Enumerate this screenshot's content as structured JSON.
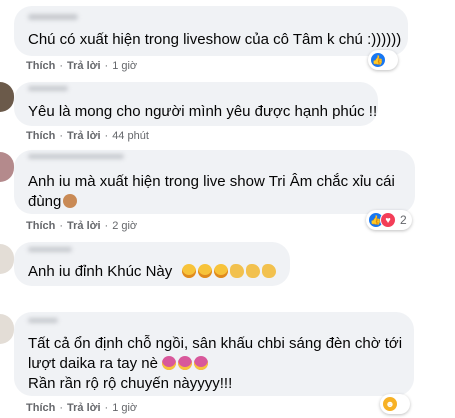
{
  "comments": [
    {
      "text_lines": [
        "Chú có xuất hiện trong liveshow của cô Tâm k chú :))))))"
      ],
      "like_label": "Thích",
      "reply_label": "Trả lời",
      "time": "1 giờ",
      "reaction_icons": [
        "like-icon"
      ],
      "reaction_count": ""
    },
    {
      "text_lines": [
        "Yêu là mong cho người mình yêu được hạnh phúc !!"
      ],
      "like_label": "Thích",
      "reply_label": "Trả lời",
      "time": "44 phút"
    },
    {
      "text_lines": [
        "Anh iu mà xuất hiện trong live show Tri Âm chắc xỉu cái",
        "đùng"
      ],
      "like_label": "Thích",
      "reply_label": "Trả lời",
      "time": "2 giờ",
      "reaction_icons": [
        "like-icon",
        "love-icon"
      ],
      "reaction_count": "2"
    },
    {
      "text_lines": [
        "Anh iu đỉnh Khúc Này"
      ],
      "like_label": "",
      "reply_label": "",
      "time": ""
    },
    {
      "text_lines": [
        "Tất cả ổn định chỗ ngồi, sân khấu chbi sáng đèn chờ tới",
        "lượt daika ra tay nè",
        "Rần rần rộ rộ chuyến nàyyyy!!!"
      ],
      "like_label": "Thích",
      "reply_label": "Trả lời",
      "time": "1 giờ",
      "reaction_icons": [
        "haha-icon"
      ],
      "reaction_count": ""
    }
  ],
  "colors": {
    "bubble_bg": "#f0f2f5",
    "meta_text": "#65676b",
    "like_blue": "#1877f2",
    "love_red": "#f33e58"
  }
}
